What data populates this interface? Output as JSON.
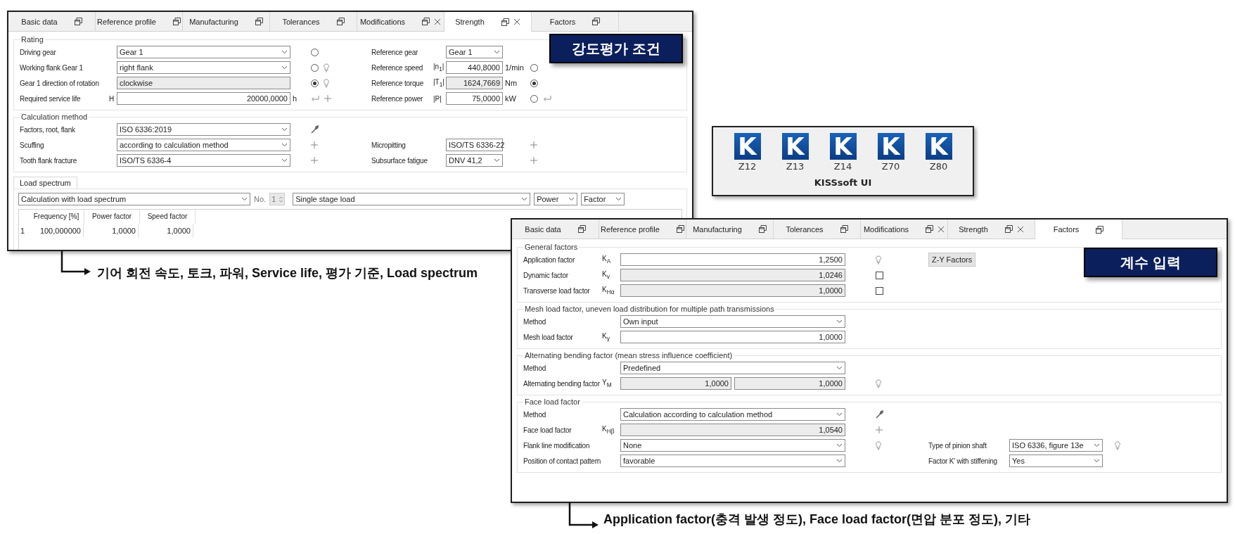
{
  "strength_window": {
    "tabs": [
      {
        "label": "Basic data",
        "selected": false,
        "closable": false
      },
      {
        "label": "Reference profile",
        "selected": false,
        "closable": false
      },
      {
        "label": "Manufacturing",
        "selected": false,
        "closable": false
      },
      {
        "label": "Tolerances",
        "selected": false,
        "closable": false
      },
      {
        "label": "Modifications",
        "selected": false,
        "closable": true
      },
      {
        "label": "Strength",
        "selected": true,
        "closable": true
      },
      {
        "label": "Factors",
        "selected": false,
        "closable": false
      }
    ],
    "rating": {
      "title": "Rating",
      "left_rows": [
        {
          "label": "Driving gear",
          "field": {
            "kind": "select",
            "value": "Gear 1",
            "readonly": false
          },
          "tools": [
            {
              "kind": "radio",
              "selected": false
            }
          ]
        },
        {
          "label": "Working flank Gear 1",
          "field": {
            "kind": "select",
            "value": "right flank",
            "readonly": false
          },
          "tools": [
            {
              "kind": "radio",
              "selected": false
            },
            {
              "kind": "bulb"
            }
          ]
        },
        {
          "label": "Gear 1 direction of rotation",
          "field": {
            "kind": "text",
            "value": "clockwise",
            "readonly": true
          },
          "tools": [
            {
              "kind": "radio",
              "selected": true
            },
            {
              "kind": "bulb"
            }
          ]
        },
        {
          "label": "Required service life",
          "symbol": "H",
          "field": {
            "kind": "input",
            "value": "20000,0000",
            "readonly": false
          },
          "unit": "h",
          "tools": [
            {
              "kind": "return"
            },
            {
              "kind": "plus"
            }
          ]
        }
      ],
      "right_rows": [
        {
          "label": "Reference gear",
          "field": {
            "kind": "select",
            "value": "Gear 1",
            "readonly": false
          }
        },
        {
          "label": "Reference speed",
          "symbol": "|n$_{1}$|",
          "field": {
            "kind": "input",
            "value": "440,8000",
            "readonly": false
          },
          "unit": "1/min",
          "tools": [
            {
              "kind": "radio",
              "selected": false
            }
          ]
        },
        {
          "label": "Reference torque",
          "symbol": "|T$_{1}$|",
          "field": {
            "kind": "input",
            "value": "1624,7669",
            "readonly": true
          },
          "unit": "Nm",
          "tools": [
            {
              "kind": "radio",
              "selected": true
            }
          ]
        },
        {
          "label": "Reference power",
          "symbol": "|P|",
          "field": {
            "kind": "input",
            "value": "75,0000",
            "readonly": false
          },
          "unit": "kW",
          "tools": [
            {
              "kind": "radio",
              "selected": false
            },
            {
              "kind": "return"
            }
          ]
        }
      ]
    },
    "calculation_method": {
      "title": "Calculation method",
      "left_rows": [
        {
          "label": "Factors, root, flank",
          "field": {
            "kind": "select",
            "value": "ISO 6336:2019",
            "readonly": false
          },
          "tools": [
            {
              "kind": "wrench"
            }
          ]
        },
        {
          "label": "Scuffing",
          "field": {
            "kind": "select",
            "value": "according to calculation method",
            "readonly": false
          },
          "tools": [
            {
              "kind": "plus"
            }
          ]
        },
        {
          "label": "Tooth flank fracture",
          "field": {
            "kind": "select",
            "value": "ISO/TS 6336-4",
            "readonly": false
          },
          "tools": [
            {
              "kind": "plus"
            }
          ]
        }
      ],
      "right_rows": [
        {
          "label": "Micropitting",
          "field": {
            "kind": "select",
            "value": "ISO/TS 6336-22",
            "readonly": false
          },
          "tools": [
            {
              "kind": "plus"
            }
          ]
        },
        {
          "label": "Subsurface fatigue",
          "field": {
            "kind": "select",
            "value": "DNV 41,2",
            "readonly": false
          },
          "tools": [
            {
              "kind": "plus"
            }
          ]
        }
      ]
    },
    "load_spectrum": {
      "tab": "Load spectrum",
      "mode": "Calculation with load spectrum",
      "no_label": "No.",
      "no_value": "1",
      "stage": "Single stage load",
      "power": "Power",
      "factor": "Factor",
      "table": {
        "columns": [
          "Frequency [%]",
          "Power factor",
          "Speed factor"
        ],
        "rows": [
          {
            "index": "1",
            "cells": [
              "100,000000",
              "1,0000",
              "1,0000"
            ]
          }
        ]
      }
    }
  },
  "strength_callout": "강도평가 조건",
  "strength_caption": "기어 회전 속도, 토크, 파워, Service life, 평가 기준, Load spectrum",
  "kisssoft": {
    "title": "KISSsoft UI",
    "apps": [
      {
        "logo": "K",
        "label": "Z12"
      },
      {
        "logo": "K",
        "label": "Z13"
      },
      {
        "logo": "K",
        "label": "Z14"
      },
      {
        "logo": "K",
        "label": "Z70"
      },
      {
        "logo": "K",
        "label": "Z80"
      }
    ]
  },
  "factors_window": {
    "tabs": [
      {
        "label": "Basic data",
        "selected": false,
        "closable": false
      },
      {
        "label": "Reference profile",
        "selected": false,
        "closable": false
      },
      {
        "label": "Manufacturing",
        "selected": false,
        "closable": false
      },
      {
        "label": "Tolerances",
        "selected": false,
        "closable": false
      },
      {
        "label": "Modifications",
        "selected": false,
        "closable": true
      },
      {
        "label": "Strength",
        "selected": false,
        "closable": true
      },
      {
        "label": "Factors",
        "selected": true,
        "closable": false
      }
    ],
    "groups": [
      {
        "title": "General factors",
        "button": "Z-Y Factors",
        "left_rows": [
          {
            "label": "Application factor",
            "symbol": "K$_{A}$",
            "field": {
              "kind": "input",
              "value": "1,2500",
              "readonly": false
            },
            "tools": [
              {
                "kind": "bulb"
              }
            ]
          },
          {
            "label": "Dynamic factor",
            "symbol": "K$_{v}$",
            "field": {
              "kind": "input",
              "value": "1,0246",
              "readonly": true
            },
            "tools": [
              {
                "kind": "checkbox",
                "checked": false
              }
            ]
          },
          {
            "label": "Transverse load factor",
            "symbol": "K$_{Hα}$",
            "field": {
              "kind": "input",
              "value": "1,0000",
              "readonly": true
            },
            "tools": [
              {
                "kind": "checkbox",
                "checked": false
              }
            ]
          }
        ]
      },
      {
        "title": "Mesh load factor, uneven load distribution for multiple path transmissions",
        "left_rows": [
          {
            "label": "Method",
            "field": {
              "kind": "select",
              "value": "Own input",
              "readonly": false
            }
          },
          {
            "label": "Mesh load factor",
            "symbol": "K$_{γ}$",
            "field": {
              "kind": "input",
              "value": "1,0000",
              "readonly": false
            }
          }
        ]
      },
      {
        "title": "Alternating bending factor (mean stress influence coefficient)",
        "left_rows": [
          {
            "label": "Method",
            "field": {
              "kind": "select",
              "value": "Predefined",
              "readonly": false
            }
          },
          {
            "label": "Alternating bending factor",
            "symbol": "Y$_{M}$",
            "field": {
              "kind": "pair",
              "values": [
                "1,0000",
                "1,0000"
              ],
              "readonly": true
            },
            "tools": [
              {
                "kind": "bulb"
              }
            ]
          }
        ]
      },
      {
        "title": "Face load factor",
        "left_rows": [
          {
            "label": "Method",
            "field": {
              "kind": "select",
              "value": "Calculation according to calculation method",
              "readonly": false
            },
            "tools": [
              {
                "kind": "wrench"
              }
            ]
          },
          {
            "label": "Face load factor",
            "symbol": "K$_{Hβ}$",
            "field": {
              "kind": "input",
              "value": "1,0540",
              "readonly": true
            },
            "tools": [
              {
                "kind": "plus"
              }
            ]
          },
          {
            "label": "Flank line modification",
            "field": {
              "kind": "select",
              "value": "None",
              "readonly": false
            },
            "tools": [
              {
                "kind": "bulb"
              }
            ]
          },
          {
            "label": "Position of contact pattern",
            "field": {
              "kind": "select",
              "value": "favorable",
              "readonly": false
            }
          }
        ],
        "right_rows": [
          {
            "label": "Type of pinion shaft",
            "field": {
              "kind": "select",
              "value": "ISO 6336, figure 13e",
              "readonly": false
            },
            "tools": [
              {
                "kind": "bulb"
              }
            ]
          },
          {
            "label": "Factor K' with stiffening",
            "field": {
              "kind": "select",
              "value": "Yes",
              "readonly": false
            }
          }
        ]
      }
    ]
  },
  "factors_callout": "계수 입력",
  "factors_caption": "Application factor(충격 발생 정도), Face load factor(면압 분포 정도), 기타"
}
